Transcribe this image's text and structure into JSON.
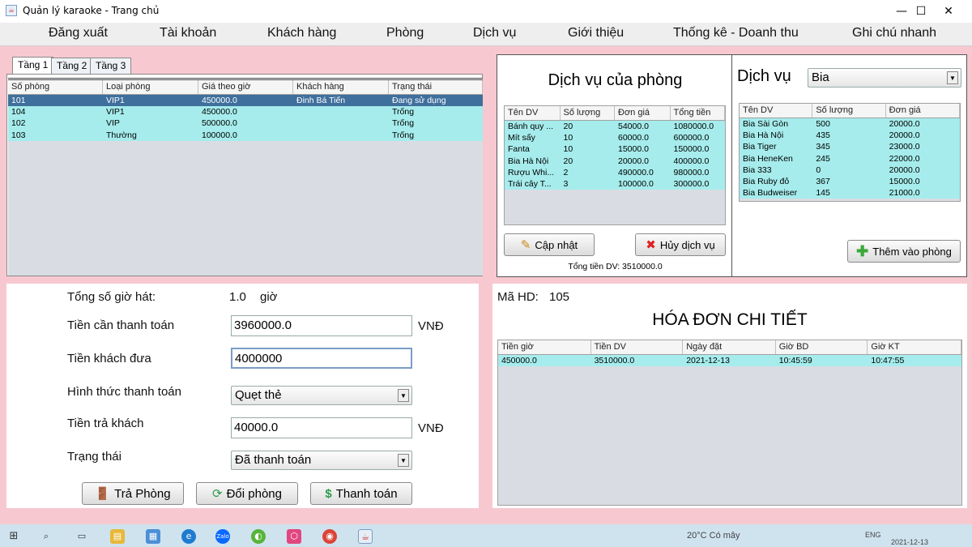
{
  "window": {
    "title": "Quản lý karaoke - Trang chủ",
    "minimize": "—",
    "maximize": "☐",
    "close": "✕"
  },
  "menu": [
    "Đăng xuất",
    "Tài khoản",
    "Khách hàng",
    "Phòng",
    "Dịch vụ",
    "Giới thiệu",
    "Thống kê - Doanh thu",
    "Ghi chú nhanh"
  ],
  "tabs": [
    "Tầng 1",
    "Tầng 2",
    "Tầng 3"
  ],
  "rooms": {
    "columns": [
      "Số phòng",
      "Loại phòng",
      "Giá theo giờ",
      "Khách hàng",
      "Trạng thái"
    ],
    "rows": [
      [
        "101",
        "VIP1",
        "450000.0",
        "Đinh Bá Tiến",
        "Đang sử dụng"
      ],
      [
        "104",
        "VIP1",
        "450000.0",
        "",
        "Trống"
      ],
      [
        "102",
        "VIP",
        "500000.0",
        "",
        "Trống"
      ],
      [
        "103",
        "Thường",
        "100000.0",
        "",
        "Trống"
      ]
    ]
  },
  "room_services": {
    "title": "Dịch vụ của phòng",
    "columns": [
      "Tên DV",
      "Số lượng",
      "Đơn giá",
      "Tổng tiền"
    ],
    "rows": [
      [
        "Bánh quy ...",
        "20",
        "54000.0",
        "1080000.0"
      ],
      [
        "Mít sấy",
        "10",
        "60000.0",
        "600000.0"
      ],
      [
        "Fanta",
        "10",
        "15000.0",
        "150000.0"
      ],
      [
        "Bia Hà Nội",
        "20",
        "20000.0",
        "400000.0"
      ],
      [
        "Rượu Whi...",
        "2",
        "490000.0",
        "980000.0"
      ],
      [
        "Trái cây T...",
        "3",
        "100000.0",
        "300000.0"
      ]
    ],
    "update_button": "Cập nhật",
    "cancel_button": "Hủy dịch vụ",
    "total_label": "Tổng tiền DV:",
    "total_value": "3510000.0"
  },
  "services": {
    "title": "Dịch vụ",
    "selected_category": "Bia",
    "columns": [
      "Tên DV",
      "Số lượng",
      "Đơn giá"
    ],
    "rows": [
      [
        "Bia Sài Gòn",
        "500",
        "20000.0"
      ],
      [
        "Bia Hà Nội",
        "435",
        "20000.0"
      ],
      [
        "Bia Tiger",
        "345",
        "23000.0"
      ],
      [
        "Bia HeneKen",
        "245",
        "22000.0"
      ],
      [
        "Bia 333",
        "0",
        "20000.0"
      ],
      [
        "Bia Ruby đỏ",
        "367",
        "15000.0"
      ],
      [
        "Bia Budweiser",
        "145",
        "21000.0"
      ]
    ],
    "add_button": "Thêm vào phòng"
  },
  "payment": {
    "hours_label": "Tổng số giờ hát:",
    "hours_value": "1.0",
    "hours_unit": "giờ",
    "due_label": "Tiền cần thanh toán",
    "due_value": "3960000.0",
    "currency": "VNĐ",
    "given_label": "Tiền khách đưa",
    "given_value": "4000000",
    "method_label": "Hình thức thanh toán",
    "method_value": "Quẹt thẻ",
    "change_label": "Tiền trả khách",
    "change_value": "40000.0",
    "status_label": "Trạng thái",
    "status_value": "Đã thanh toán",
    "checkout_button": "Trả Phòng",
    "switch_button": "Đổi phòng",
    "pay_button": "Thanh toán"
  },
  "invoice": {
    "id_label": "Mã HD:",
    "id_value": "105",
    "title": "HÓA ĐƠN CHI TIẾT",
    "columns": [
      "Tiền giờ",
      "Tiền DV",
      "Ngày đặt",
      "Giờ BD",
      "Giờ KT"
    ],
    "rows": [
      [
        "450000.0",
        "3510000.0",
        "2021-12-13",
        "10:45:59",
        "10:47:55"
      ]
    ]
  },
  "taskbar": {
    "weather": "20°C Có mây",
    "lang": "ENG",
    "date": "2021-12-13"
  },
  "colors": {
    "pink_bg": "#f7c8d0",
    "row_cyan": "#a6ecec",
    "row_selected": "#3f6f9c"
  }
}
